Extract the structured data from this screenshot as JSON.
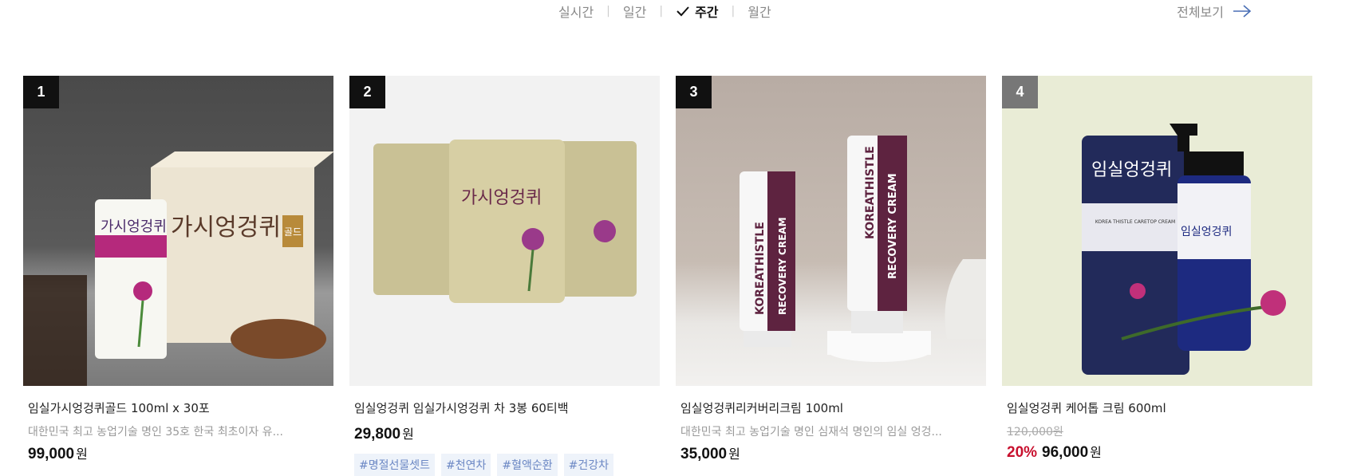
{
  "period_tabs": [
    {
      "label": "실시간",
      "active": false
    },
    {
      "label": "일간",
      "active": false
    },
    {
      "label": "주간",
      "active": true
    },
    {
      "label": "월간",
      "active": false
    }
  ],
  "view_all_label": "전체보기",
  "products": [
    {
      "rank": "1",
      "rank_color": "#111111",
      "name": "임실가시엉겅퀴골드 100ml x 30포",
      "desc": "대한민국 최고 농업기술 명인 35호 한국 최초이자 유...",
      "price": "99,000",
      "won": "원"
    },
    {
      "rank": "2",
      "rank_color": "#111111",
      "name": "임실엉겅퀴 임실가시엉겅퀴 차 3봉 60티백",
      "price": "29,800",
      "won": "원",
      "tags": [
        "#명절선물셋트",
        "#천연차",
        "#혈액순환",
        "#건강차"
      ]
    },
    {
      "rank": "3",
      "rank_color": "#111111",
      "name": "임실엉겅퀴리커버리크림 100ml",
      "desc": "대한민국 최고 농업기술 명인 심재석 명인의 임실 엉겅...",
      "price": "35,000",
      "won": "원"
    },
    {
      "rank": "4",
      "rank_color": "#777777",
      "name": "임실엉겅퀴 케어톱 크림 600ml",
      "original_price": "120,000원",
      "discount": "20%",
      "price": "96,000",
      "won": "원"
    }
  ],
  "image_text": {
    "p1_box": "가시엉겅퀴",
    "p1_gold": "골드",
    "p1_pouch": "가시엉겅퀴",
    "p2_pouch": "가시엉겅퀴",
    "p3_brand": "KOREATHISTLE",
    "p3_product": "RECOVERY CREAM",
    "p4_can": "임실엉겅퀴",
    "p4_bottle": "임실엉겅퀴",
    "p4_label": "KOREA THISTLE CARETOP CREAM"
  }
}
